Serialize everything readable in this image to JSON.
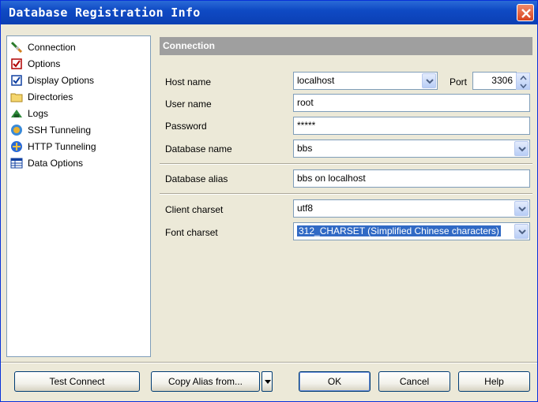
{
  "window": {
    "title": "Database Registration Info"
  },
  "sidebar": {
    "items": [
      {
        "label": "Connection",
        "icon": "connection-icon"
      },
      {
        "label": "Options",
        "icon": "options-icon"
      },
      {
        "label": "Display Options",
        "icon": "display-options-icon"
      },
      {
        "label": "Directories",
        "icon": "folder-icon"
      },
      {
        "label": "Logs",
        "icon": "logs-icon"
      },
      {
        "label": "SSH Tunneling",
        "icon": "ssh-tunneling-icon"
      },
      {
        "label": "HTTP Tunneling",
        "icon": "http-tunneling-icon"
      },
      {
        "label": "Data Options",
        "icon": "data-options-icon"
      }
    ]
  },
  "main": {
    "header": "Connection",
    "host": {
      "label": "Host name",
      "value": "localhost"
    },
    "port": {
      "label": "Port",
      "value": "3306"
    },
    "user": {
      "label": "User name",
      "value": "root"
    },
    "password": {
      "label": "Password",
      "value": "*****"
    },
    "database": {
      "label": "Database name",
      "value": "bbs"
    },
    "alias": {
      "label": "Database alias",
      "value": "bbs on localhost"
    },
    "client_charset": {
      "label": "Client charset",
      "value": "utf8"
    },
    "font_charset": {
      "label": "Font charset",
      "value": "312_CHARSET (Simplified Chinese characters)"
    }
  },
  "buttons": {
    "test_connect": "Test Connect",
    "copy_alias": "Copy Alias from...",
    "ok": "OK",
    "cancel": "Cancel",
    "help": "Help"
  }
}
